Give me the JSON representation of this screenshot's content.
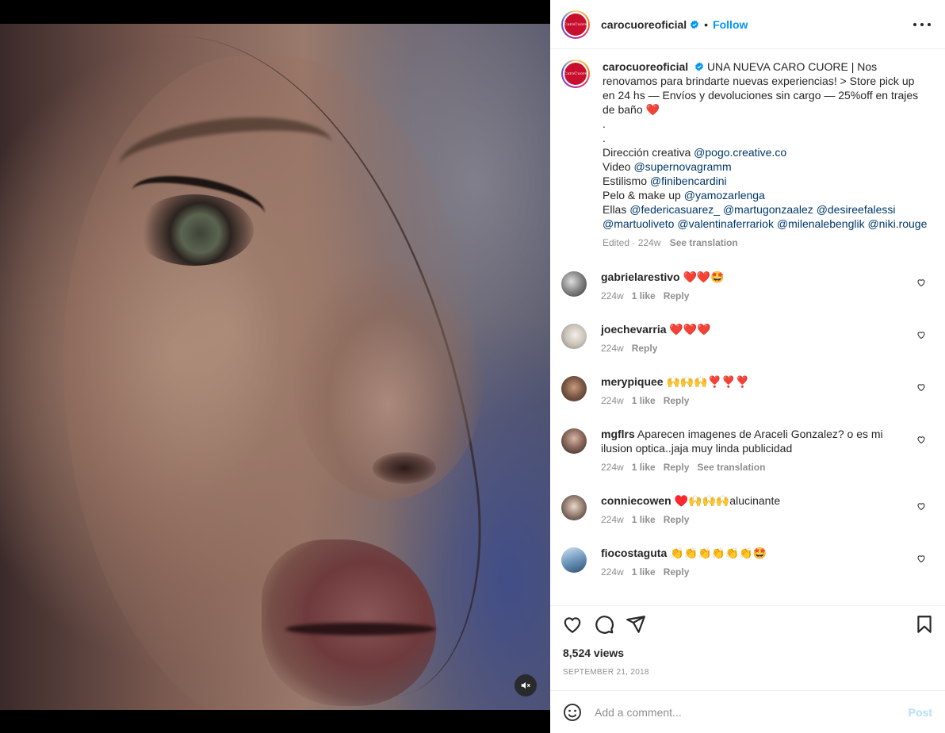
{
  "media": {
    "mute_icon": "speaker-muted-icon"
  },
  "header": {
    "username": "carocuoreoficial",
    "brand_avatar_text": "CaroCuore",
    "verified_icon": "verified-badge-icon",
    "separator": "•",
    "follow_label": "Follow",
    "more_icon": "more-options-icon"
  },
  "caption": {
    "username": "carocuoreoficial",
    "text_1": "UNA NUEVA CARO CUORE | Nos renovamos para brindarte nuevas experiencias! > Store pick up en 24 hs — Envíos y devoluciones sin cargo — 25%off en trajes de baño",
    "heart": "❤️",
    "dot_1": ".",
    "dot_2": ".",
    "line_direccion": "Dirección creativa",
    "mention_direccion": "@pogo.creative.co",
    "line_video": "Video",
    "mention_video": "@supernovagramm",
    "line_estilismo": "Estilismo",
    "mention_estilismo": "@finibencardini",
    "line_pelo": "Pelo & make up",
    "mention_pelo": "@yamozarlenga",
    "line_ellas": "Ellas",
    "ellas_mentions": [
      "@federicasuarez_",
      "@martugonzaalez",
      "@desireefalessi",
      "@martuoliveto",
      "@valentinaferrariok",
      "@milenalebenglik",
      "@niki.rouge"
    ],
    "edited": "Edited",
    "time": "224w",
    "see_translation": "See translation"
  },
  "comments": [
    {
      "username": "gabrielarestivo",
      "text": "❤️❤️🤩",
      "time": "224w",
      "likes": "1 like",
      "reply": "Reply",
      "translation": ""
    },
    {
      "username": "joechevarria",
      "text": "❤️❤️❤️",
      "time": "224w",
      "likes": "",
      "reply": "Reply",
      "translation": ""
    },
    {
      "username": "merypiquee",
      "text": "🙌🙌🙌❣️❣️❣️",
      "time": "224w",
      "likes": "1 like",
      "reply": "Reply",
      "translation": ""
    },
    {
      "username": "mgflrs",
      "text": "Aparecen imagenes de Araceli Gonzalez? o es mi ilusion optica..jaja muy linda publicidad",
      "time": "224w",
      "likes": "1 like",
      "reply": "Reply",
      "translation": "See translation"
    },
    {
      "username": "conniecowen",
      "text": "♥️🙌🙌🙌alucinante",
      "time": "224w",
      "likes": "1 like",
      "reply": "Reply",
      "translation": ""
    },
    {
      "username": "fiocostaguta",
      "text": "👏👏👏👏👏👏🤩",
      "time": "224w",
      "likes": "1 like",
      "reply": "Reply",
      "translation": ""
    }
  ],
  "actions": {
    "like_icon": "heart-icon",
    "comment_icon": "comment-icon",
    "share_icon": "share-icon",
    "save_icon": "bookmark-icon",
    "views": "8,524 views",
    "date": "SEPTEMBER 21, 2018"
  },
  "add_comment": {
    "emoji_icon": "emoji-icon",
    "placeholder": "Add a comment...",
    "post_label": "Post"
  },
  "colors": {
    "accent": "#0095f6",
    "mention": "#00376b",
    "muted": "#8e8e8e",
    "brand": "#c8102e"
  }
}
